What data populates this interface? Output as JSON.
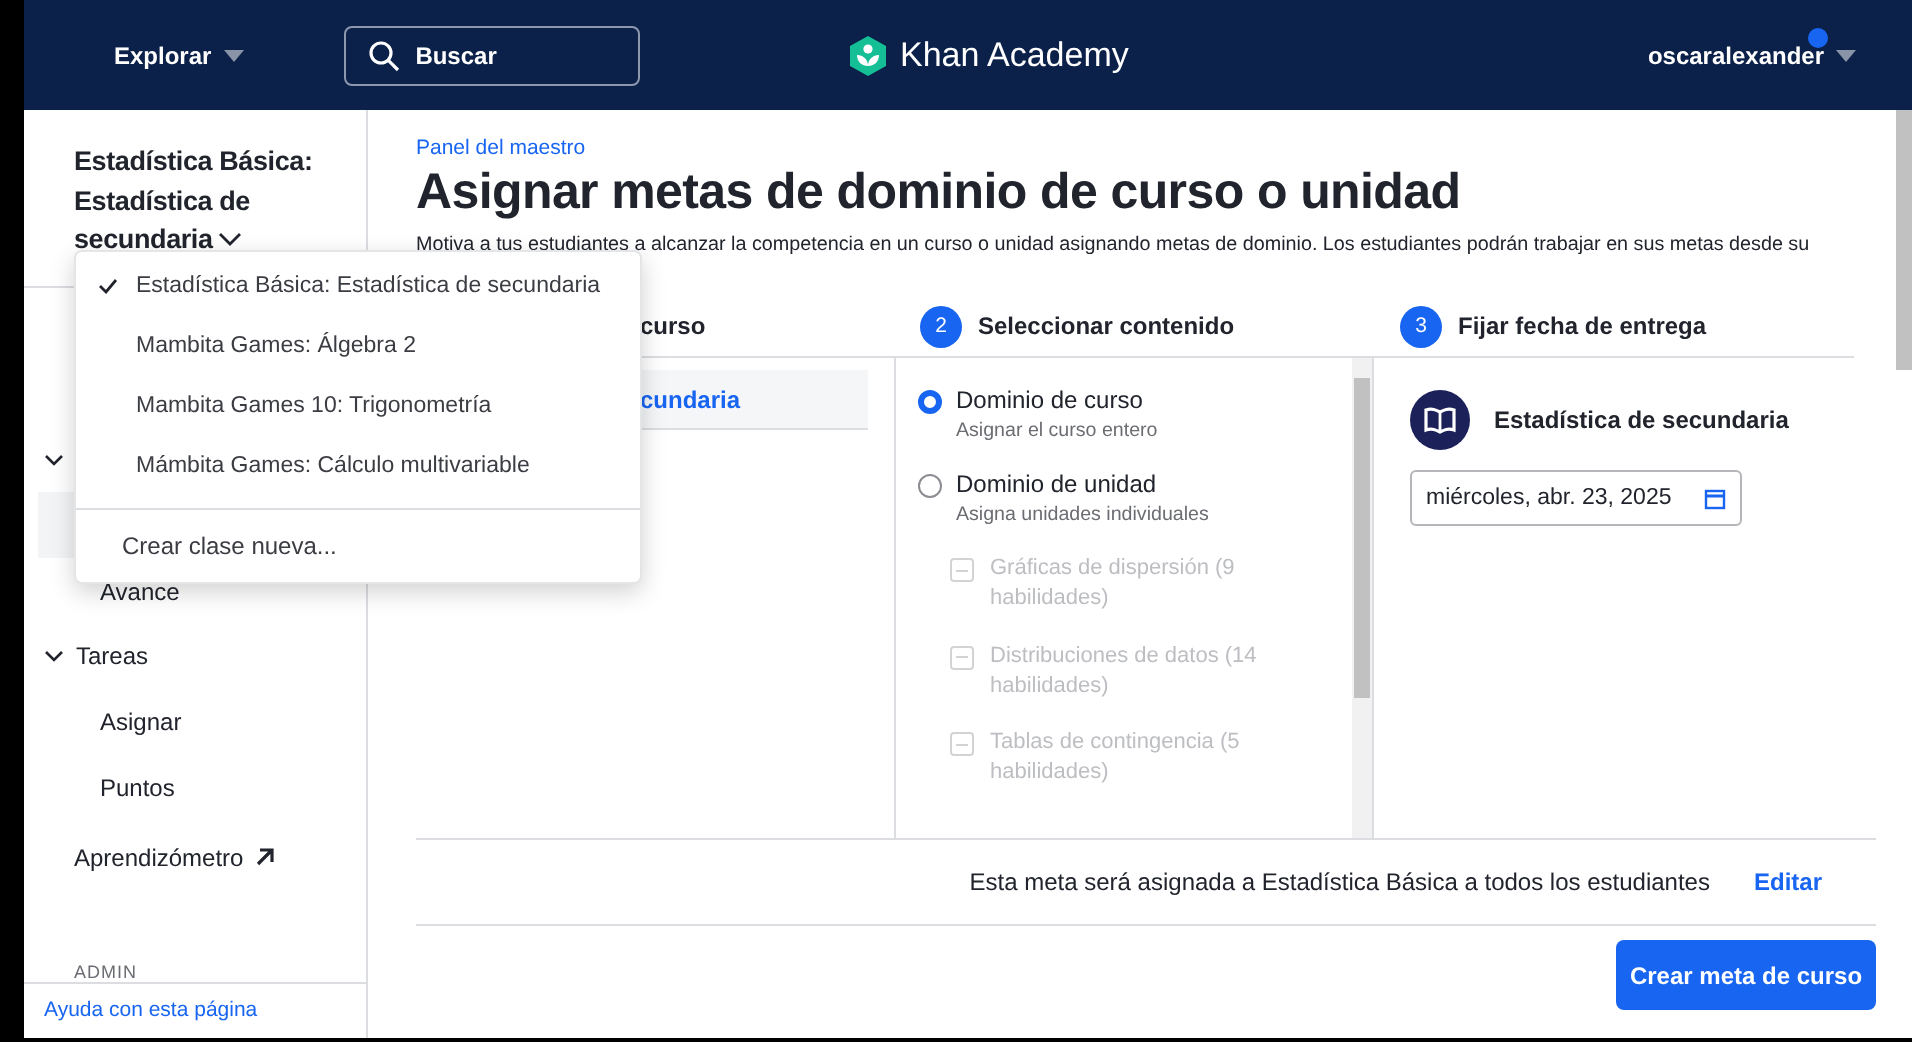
{
  "header": {
    "explore": "Explorar",
    "search": {
      "placeholder": "Buscar"
    },
    "logo": "Khan Academy",
    "user": "oscaralexander",
    "notification": true
  },
  "sidebar": {
    "class_title": "Estadística Básica: Estadística de secundaria",
    "items": [
      {
        "kind": "section",
        "expanded": true
      },
      {
        "kind": "item",
        "selected": true
      },
      {
        "kind": "item",
        "label": "Avance",
        "selected": false
      },
      {
        "kind": "section",
        "label": "Tareas",
        "expanded": true
      },
      {
        "kind": "item",
        "label": "Asignar",
        "selected": false
      },
      {
        "kind": "item",
        "label": "Puntos",
        "selected": false
      },
      {
        "kind": "external",
        "label": "Aprendizómetro"
      },
      {
        "kind": "heading",
        "label": "ADMIN"
      }
    ],
    "help": "Ayuda con esta página"
  },
  "class_menu": {
    "items": [
      {
        "label": "Estadística Básica: Estadística de secundaria",
        "selected": true
      },
      {
        "label": "Mambita Games: Álgebra 2",
        "selected": false
      },
      {
        "label": "Mambita Games 10: Trigonometría",
        "selected": false
      },
      {
        "label": "Mámbita Games: Cálculo multivariable",
        "selected": false
      }
    ],
    "create": "Crear clase nueva..."
  },
  "main": {
    "breadcrumb": "Panel del maestro",
    "title": "Asignar metas de dominio de curso o unidad",
    "description": "Motiva a tus estudiantes a alcanzar la competencia en un curso o unidad asignando metas de dominio. Los estudiantes podrán trabajar en sus metas desde su",
    "steps": [
      {
        "label": "curso"
      },
      {
        "number": "2",
        "label": "Seleccionar contenido"
      },
      {
        "number": "3",
        "label": "Fijar fecha de entrega"
      }
    ],
    "courses": [
      {
        "label": "cundaria",
        "selected": true
      }
    ],
    "options": [
      {
        "label": "Dominio de curso",
        "sub": "Asignar el curso entero",
        "selected": true
      },
      {
        "label": "Dominio de unidad",
        "sub": "Asigna unidades individuales",
        "selected": false
      }
    ],
    "units": [
      {
        "label": "Gráficas de dispersión (9 habilidades)",
        "disabled": true
      },
      {
        "label": "Distribuciones de datos (14 habilidades)",
        "disabled": true
      },
      {
        "label": "Tablas de contingencia (5 habilidades)",
        "disabled": true
      }
    ],
    "course_name": "Estadística de secundaria",
    "due_date": "miércoles, abr. 23, 2025",
    "summary": "Esta meta será asignada a Estadística Básica a todos los estudiantes",
    "edit": "Editar",
    "submit": "Crear meta de curso"
  }
}
